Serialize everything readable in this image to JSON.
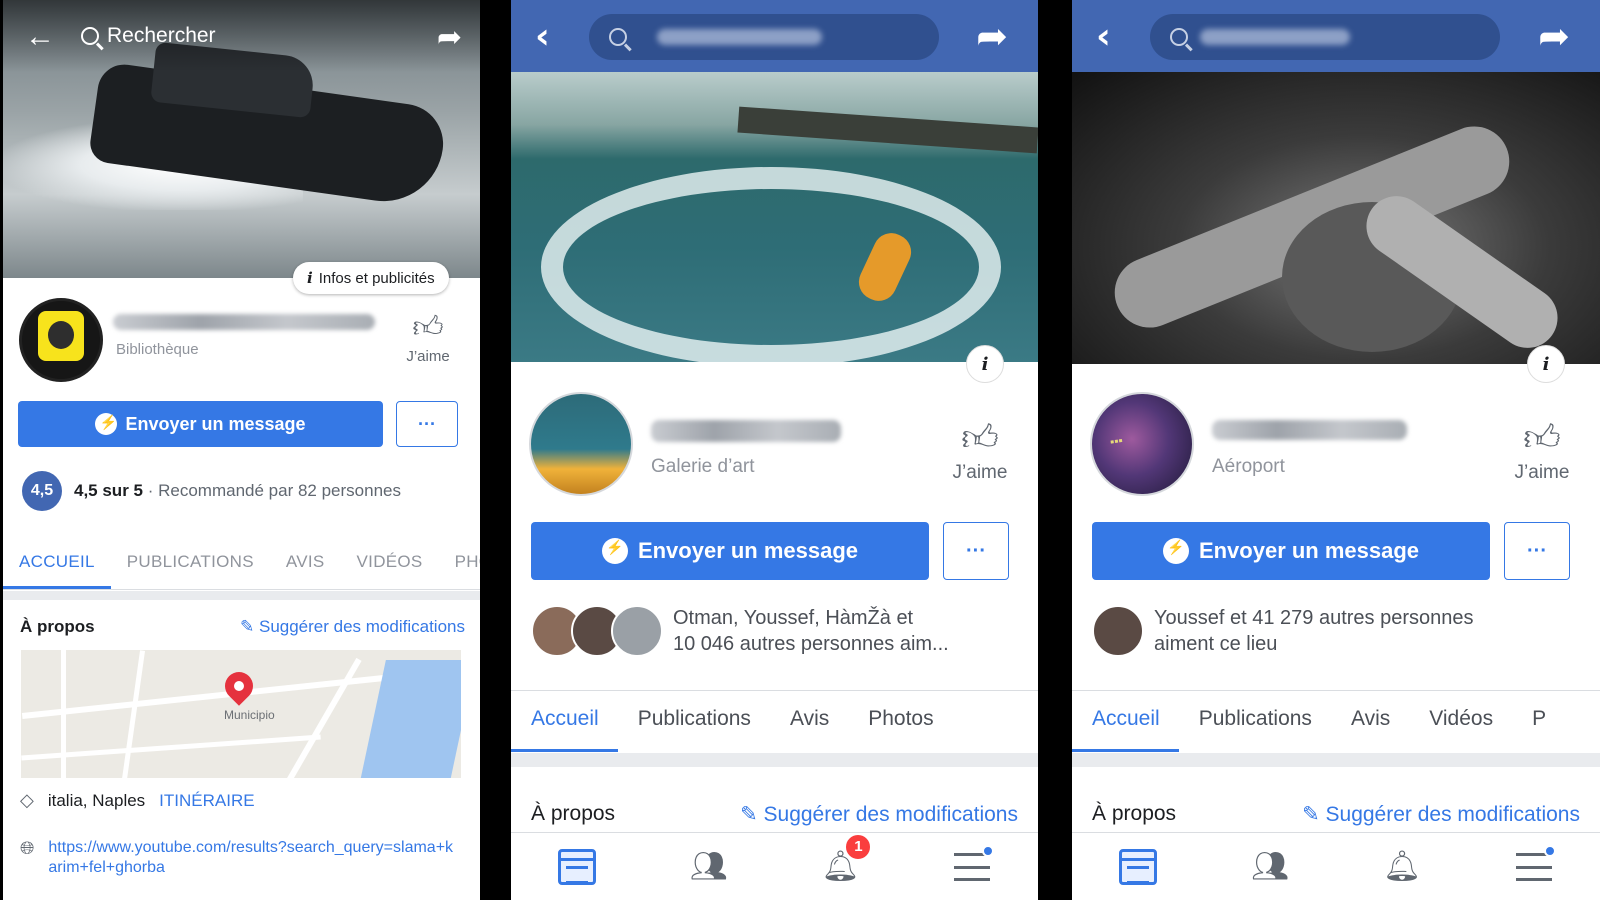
{
  "panel1": {
    "search_placeholder": "Rechercher",
    "infos_pill": "Infos et publicités",
    "category": "Bibliothèque",
    "like_label": "J’aime",
    "message_button": "Envoyer un message",
    "more_button": "···",
    "rating_badge": "4,5",
    "rating_strong": "4,5 sur 5",
    "rating_rest": " · Recommandé par 82 personnes",
    "tabs": [
      "ACCUEIL",
      "PUBLICATIONS",
      "AVIS",
      "VIDÉOS",
      "PHO"
    ],
    "about_title": "À propos",
    "suggest_link": "Suggérer des modifications",
    "map_label": "Municipio",
    "location": "italia, Naples",
    "itinerary": "ITINÉRAIRE",
    "url": "https://www.youtube.com/results?search_query=slama+karim+fel+ghorba"
  },
  "panel2": {
    "category": "Galerie d’art",
    "like_label": "J’aime",
    "message_button": "Envoyer un message",
    "more_button": "···",
    "friends_line1": "Otman, Youssef, HàmŽà et",
    "friends_line2": "10 046 autres personnes aim...",
    "tabs": [
      "Accueil",
      "Publications",
      "Avis",
      "Photos"
    ],
    "about_title": "À propos",
    "suggest_link": "Suggérer des modifications",
    "notification_count": "1"
  },
  "panel3": {
    "category": "Aéroport",
    "like_label": "J’aime",
    "message_button": "Envoyer un message",
    "more_button": "···",
    "friends_line1": "Youssef et 41 279 autres personnes",
    "friends_line2": "aiment ce lieu",
    "tabs": [
      "Accueil",
      "Publications",
      "Avis",
      "Vidéos",
      "P"
    ],
    "about_title": "À propos",
    "suggest_link": "Suggérer des modifications"
  },
  "icons": {
    "back": "back-arrow-icon",
    "search": "search-icon",
    "share": "share-icon",
    "info": "info-icon",
    "like": "thumbs-up-icon",
    "messenger": "messenger-icon",
    "pencil": "pencil-icon",
    "location": "location-tag-icon",
    "globe": "globe-icon",
    "feed": "news-feed-icon",
    "friends": "friends-icon",
    "bell": "bell-icon",
    "menu": "menu-icon"
  },
  "colors": {
    "facebook_blue": "#4267b2",
    "button_blue": "#3578e5",
    "notification_red": "#fa3e3e"
  }
}
